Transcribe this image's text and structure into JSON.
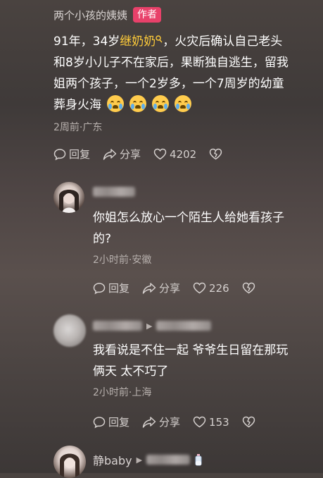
{
  "comment1": {
    "username": "两个小孩的姨姨",
    "author_tag": "作者",
    "text_line1_prefix": "91年，34岁",
    "text_link": "继奶奶",
    "text_line1_suffix": "，火灾后确认自己老头",
    "text_line2": "和8岁小儿子不在家后，果断独自逃生，留我",
    "text_line3": "姐两个孩子，一个2岁多，一个7周岁的幼童",
    "text_line4": "葬身火海",
    "emoji_count": 4,
    "emoji_name": "crying-face",
    "meta": "2周前·广东",
    "reply_label": "回复",
    "share_label": "分享",
    "like_count": "4202"
  },
  "comment2": {
    "text_line1": "你姐怎么放心一个陌生人给她看孩子",
    "text_line2": "的?",
    "meta": "2小时前·安徽",
    "reply_label": "回复",
    "share_label": "分享",
    "like_count": "226"
  },
  "comment3": {
    "text_line1": "我看说是不住一起 爷爷生日留在那玩",
    "text_line2": "俩天 太不巧了",
    "meta": "2小时前·上海",
    "reply_label": "回复",
    "share_label": "分享",
    "like_count": "153"
  },
  "comment4": {
    "username": "静baby"
  },
  "colors": {
    "link": "#ffcc3a",
    "author_tag_bg": "#e8416a",
    "meta_text": "#b7b0ad"
  }
}
